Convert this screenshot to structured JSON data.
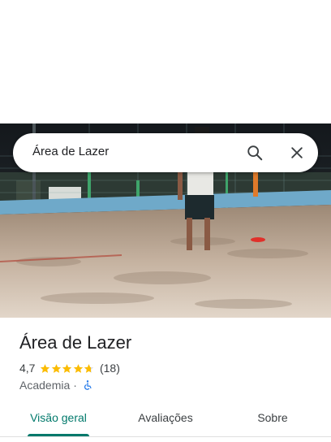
{
  "search": {
    "query": "Área de Lazer",
    "search_icon": "search-icon",
    "close_icon": "close-icon"
  },
  "place": {
    "photo": "beach-sand-court-photo",
    "name": "Área de Lazer",
    "rating": "4,7",
    "stars_filled": 4.7,
    "reviews": "(18)",
    "category": "Academia",
    "separator": "·",
    "accessibility_icon": "wheelchair-icon"
  },
  "tabs": [
    {
      "label": "Visão geral",
      "active": true
    },
    {
      "label": "Avaliações",
      "active": false
    },
    {
      "label": "Sobre",
      "active": false
    }
  ],
  "colors": {
    "accent": "#00796b",
    "star": "#fbbc04",
    "accessibility": "#1a73e8"
  }
}
